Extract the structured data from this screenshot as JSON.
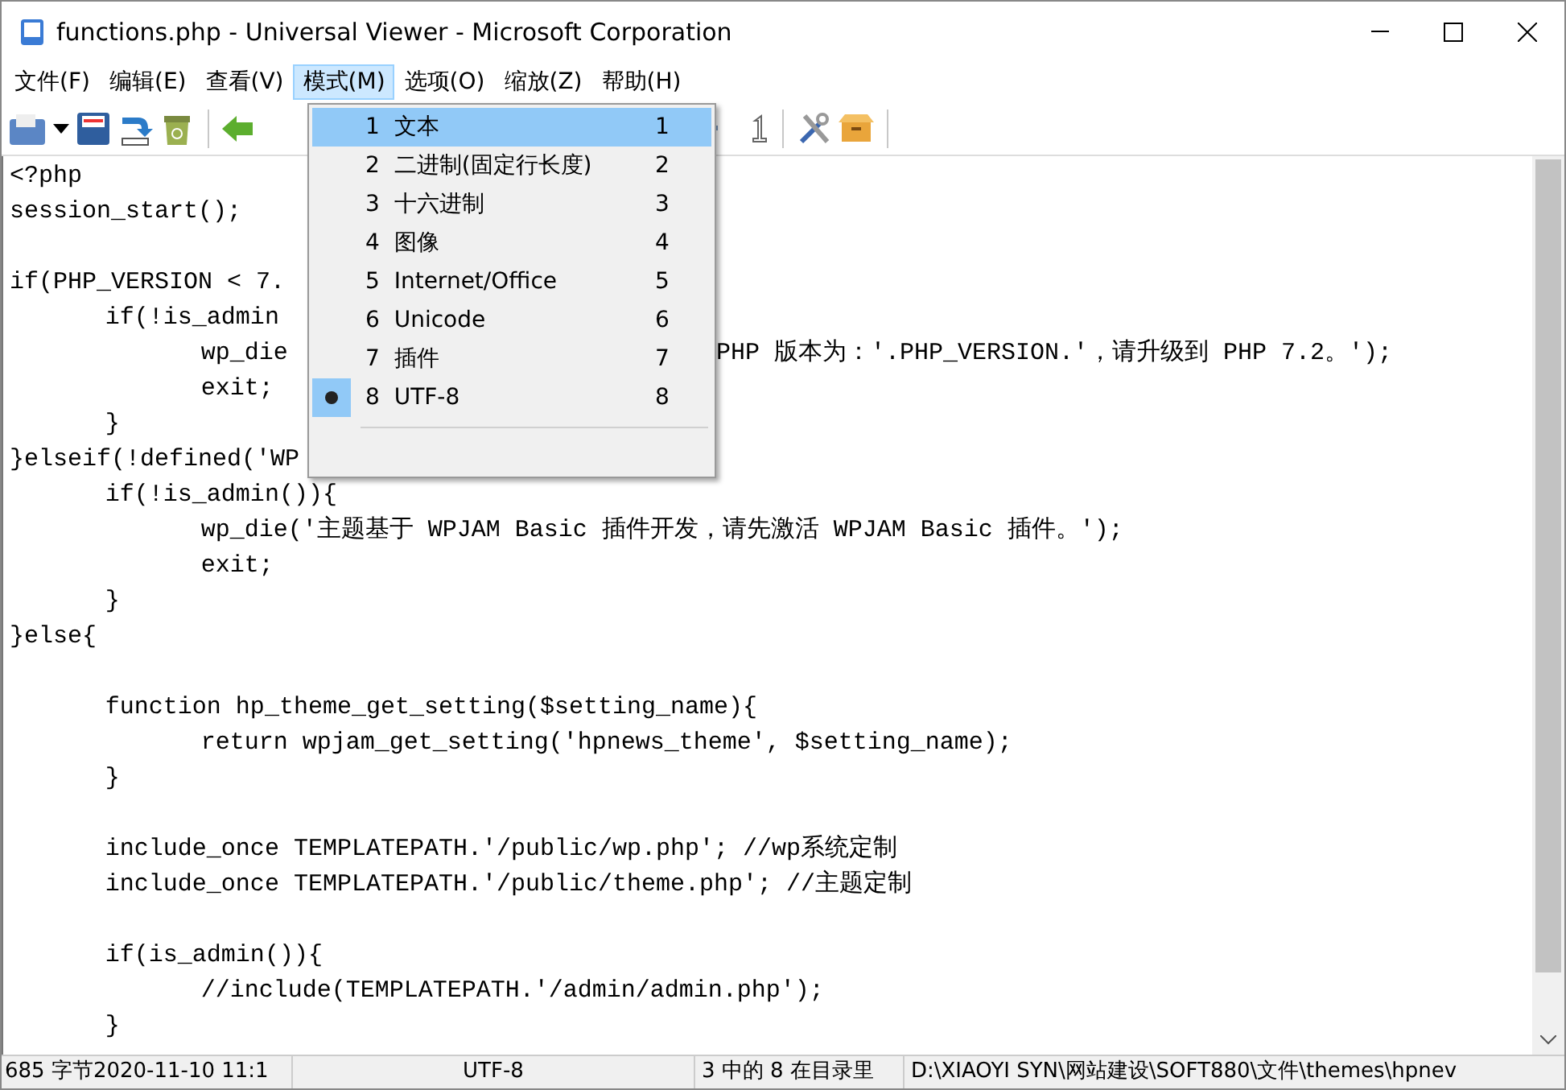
{
  "window": {
    "title": "functions.php - Universal Viewer - Microsoft Corporation"
  },
  "menu_bar": [
    {
      "label": "文件(F)",
      "selected": false
    },
    {
      "label": "编辑(E)",
      "selected": false
    },
    {
      "label": "查看(V)",
      "selected": false
    },
    {
      "label": "模式(M)",
      "selected": true
    },
    {
      "label": "选项(O)",
      "selected": false
    },
    {
      "label": "缩放(Z)",
      "selected": false
    },
    {
      "label": "帮助(H)",
      "selected": false
    }
  ],
  "code_lines": [
    {
      "text": "<?php",
      "gap_before": false
    },
    {
      "text": "session_start();",
      "gap_before": false
    },
    {
      "text": "if(PHP_VERSION < 7.",
      "gap_before": true
    },
    {
      "text": "\tif(!is_admin",
      "gap_before": false
    },
    {
      "text": "\t\twp_die",
      "text_after_menu": "PHP 版本为：'.PHP_VERSION.'，请升级到 PHP 7.2。');",
      "gap_before": false
    },
    {
      "text": "\t\texit;",
      "gap_before": false
    },
    {
      "text": "\t}",
      "gap_before": false
    },
    {
      "text": "}elseif(!defined('WP",
      "gap_before": false
    },
    {
      "text": "\tif(!is_admin()){",
      "gap_before": false
    },
    {
      "text": "\t\twp_die('主题基于 WPJAM Basic 插件开发，请先激活 WPJAM Basic 插件。');",
      "gap_before": false
    },
    {
      "text": "\t\texit;",
      "gap_before": false
    },
    {
      "text": "\t}",
      "gap_before": false
    },
    {
      "text": "}else{",
      "gap_before": false
    },
    {
      "text": "\tfunction hp_theme_get_setting($setting_name){",
      "gap_before": true
    },
    {
      "text": "\t\treturn wpjam_get_setting('hpnews_theme', $setting_name);",
      "gap_before": false
    },
    {
      "text": "\t}",
      "gap_before": false
    },
    {
      "text": "\tinclude_once TEMPLATEPATH.'/public/wp.php'; //wp系统定制",
      "gap_before": true
    },
    {
      "text": "\tinclude_once TEMPLATEPATH.'/public/theme.php'; //主题定制",
      "gap_before": false
    },
    {
      "text": "\tif(is_admin()){",
      "gap_before": true
    },
    {
      "text": "\t\t//include(TEMPLATEPATH.'/admin/admin.php');",
      "gap_before": false
    },
    {
      "text": "\t}",
      "gap_before": false
    }
  ],
  "mode_menu": {
    "items": [
      {
        "number": "1",
        "label": "文本",
        "shortcut": "1",
        "selected": true,
        "checked": false
      },
      {
        "number": "2",
        "label": "二进制(固定行长度)",
        "shortcut": "2",
        "selected": false,
        "checked": false
      },
      {
        "number": "3",
        "label": "十六进制",
        "shortcut": "3",
        "selected": false,
        "checked": false
      },
      {
        "number": "4",
        "label": "图像",
        "shortcut": "4",
        "selected": false,
        "checked": false
      },
      {
        "number": "5",
        "label": "Internet/Office",
        "shortcut": "5",
        "selected": false,
        "checked": false
      },
      {
        "number": "6",
        "label": "Unicode",
        "shortcut": "6",
        "selected": false,
        "checked": false
      },
      {
        "number": "7",
        "label": "插件",
        "shortcut": "7",
        "selected": false,
        "checked": false
      },
      {
        "number": "8",
        "label": "UTF-8",
        "shortcut": "8",
        "selected": false,
        "checked": true
      }
    ]
  },
  "status_bar": {
    "size_date": "685 字节2020-11-10 11:1",
    "encoding": "UTF-8",
    "position": "3 中的 8 在目录里",
    "path": "D:\\XIAOYI SYN\\网站建设\\SOFT880\\文件\\themes\\hpnev"
  }
}
